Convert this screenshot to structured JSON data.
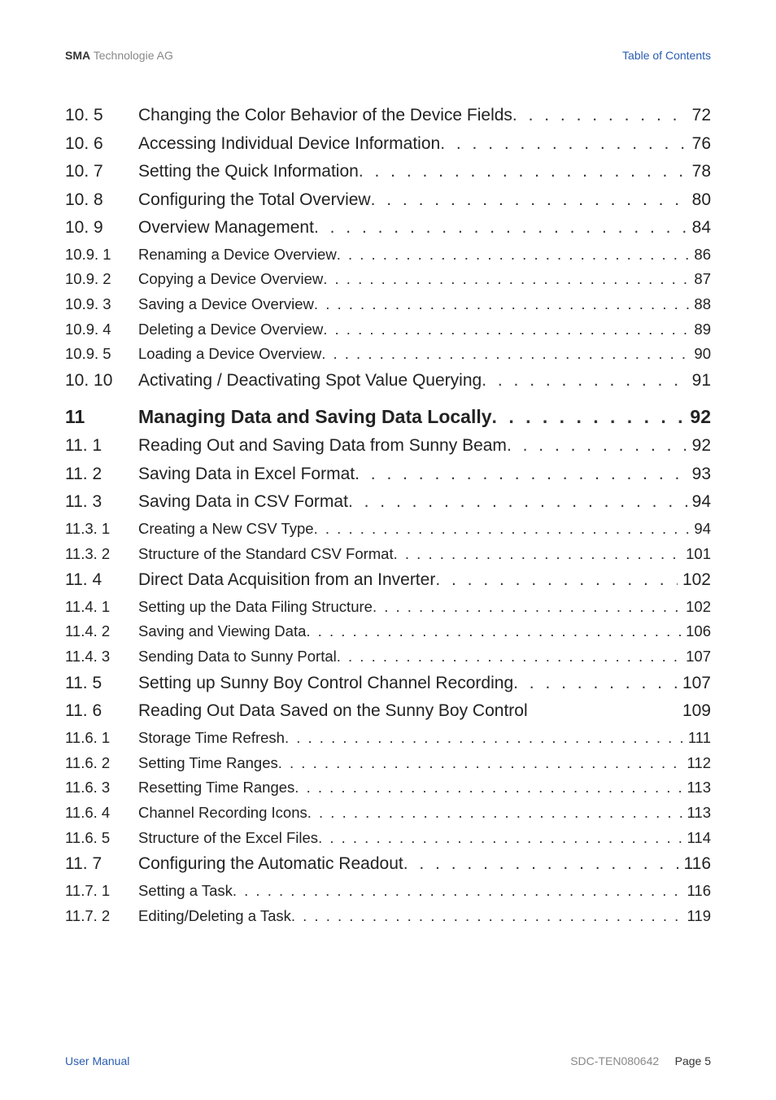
{
  "header": {
    "brand_bold": "SMA",
    "brand_light": " Technologie AG",
    "right": "Table of Contents"
  },
  "toc": [
    {
      "level": 2,
      "num": "10. 5",
      "title": "Changing the Color Behavior of the Device Fields",
      "page": "72"
    },
    {
      "level": 2,
      "num": "10. 6",
      "title": "Accessing Individual Device Information",
      "page": "76"
    },
    {
      "level": 2,
      "num": "10. 7",
      "title": "Setting the Quick Information",
      "page": "78"
    },
    {
      "level": 2,
      "num": "10. 8",
      "title": "Configuring the Total Overview",
      "page": "80"
    },
    {
      "level": 2,
      "num": "10. 9",
      "title": "Overview Management",
      "page": "84"
    },
    {
      "level": 3,
      "num": "10.9. 1",
      "title": "Renaming a Device Overview",
      "page": "86"
    },
    {
      "level": 3,
      "num": "10.9. 2",
      "title": "Copying a Device Overview",
      "page": "87"
    },
    {
      "level": 3,
      "num": "10.9. 3",
      "title": "Saving a Device Overview",
      "page": "88"
    },
    {
      "level": 3,
      "num": "10.9. 4",
      "title": "Deleting a Device Overview",
      "page": "89"
    },
    {
      "level": 3,
      "num": "10.9. 5",
      "title": "Loading a Device Overview",
      "page": "90"
    },
    {
      "level": 2,
      "num": "10. 10",
      "title": "Activating / Deactivating Spot Value Querying",
      "page": "91"
    },
    {
      "level": 1,
      "num": "11",
      "title": "Managing Data and Saving Data Locally",
      "page": "92"
    },
    {
      "level": 2,
      "num": "11. 1",
      "title": "Reading Out and Saving Data from Sunny Beam",
      "page": "92"
    },
    {
      "level": 2,
      "num": "11. 2",
      "title": "Saving Data in Excel Format",
      "page": "93"
    },
    {
      "level": 2,
      "num": "11. 3",
      "title": "Saving Data in CSV Format",
      "page": "94"
    },
    {
      "level": 3,
      "num": "11.3. 1",
      "title": "Creating a New CSV Type",
      "page": "94"
    },
    {
      "level": 3,
      "num": "11.3. 2",
      "title": "Structure of the Standard CSV Format",
      "page": "101"
    },
    {
      "level": 2,
      "num": "11. 4",
      "title": " Direct Data Acquisition from an Inverter",
      "page": "102"
    },
    {
      "level": 3,
      "num": "11.4. 1",
      "title": "Setting up the Data Filing Structure",
      "page": "102"
    },
    {
      "level": 3,
      "num": "11.4. 2",
      "title": "Saving and Viewing Data",
      "page": "106"
    },
    {
      "level": 3,
      "num": "11.4. 3",
      "title": "Sending Data to Sunny Portal",
      "page": "107"
    },
    {
      "level": 2,
      "num": "11. 5",
      "title": "Setting up Sunny Boy Control Channel Recording",
      "page": "107"
    },
    {
      "level": 2,
      "num": "11. 6",
      "title": "Reading Out Data Saved on the Sunny Boy Control",
      "page": "109",
      "no_leader": true
    },
    {
      "level": 3,
      "num": "11.6. 1",
      "title": "Storage Time Refresh",
      "page": "111"
    },
    {
      "level": 3,
      "num": "11.6. 2",
      "title": "Setting Time Ranges",
      "page": "112"
    },
    {
      "level": 3,
      "num": "11.6. 3",
      "title": "Resetting Time Ranges",
      "page": "113"
    },
    {
      "level": 3,
      "num": "11.6. 4",
      "title": "Channel Recording Icons",
      "page": "113"
    },
    {
      "level": 3,
      "num": "11.6. 5",
      "title": "Structure of the Excel Files",
      "page": "114"
    },
    {
      "level": 2,
      "num": "11. 7",
      "title": "Configuring the Automatic Readout",
      "page": "116"
    },
    {
      "level": 3,
      "num": "11.7. 1",
      "title": "Setting a Task",
      "page": "116"
    },
    {
      "level": 3,
      "num": "11.7. 2",
      "title": "Editing/Deleting a Task",
      "page": "119"
    }
  ],
  "footer": {
    "left": "User Manual",
    "doc_id": "SDC-TEN080642",
    "page_label": "Page ",
    "page_num": "5"
  }
}
